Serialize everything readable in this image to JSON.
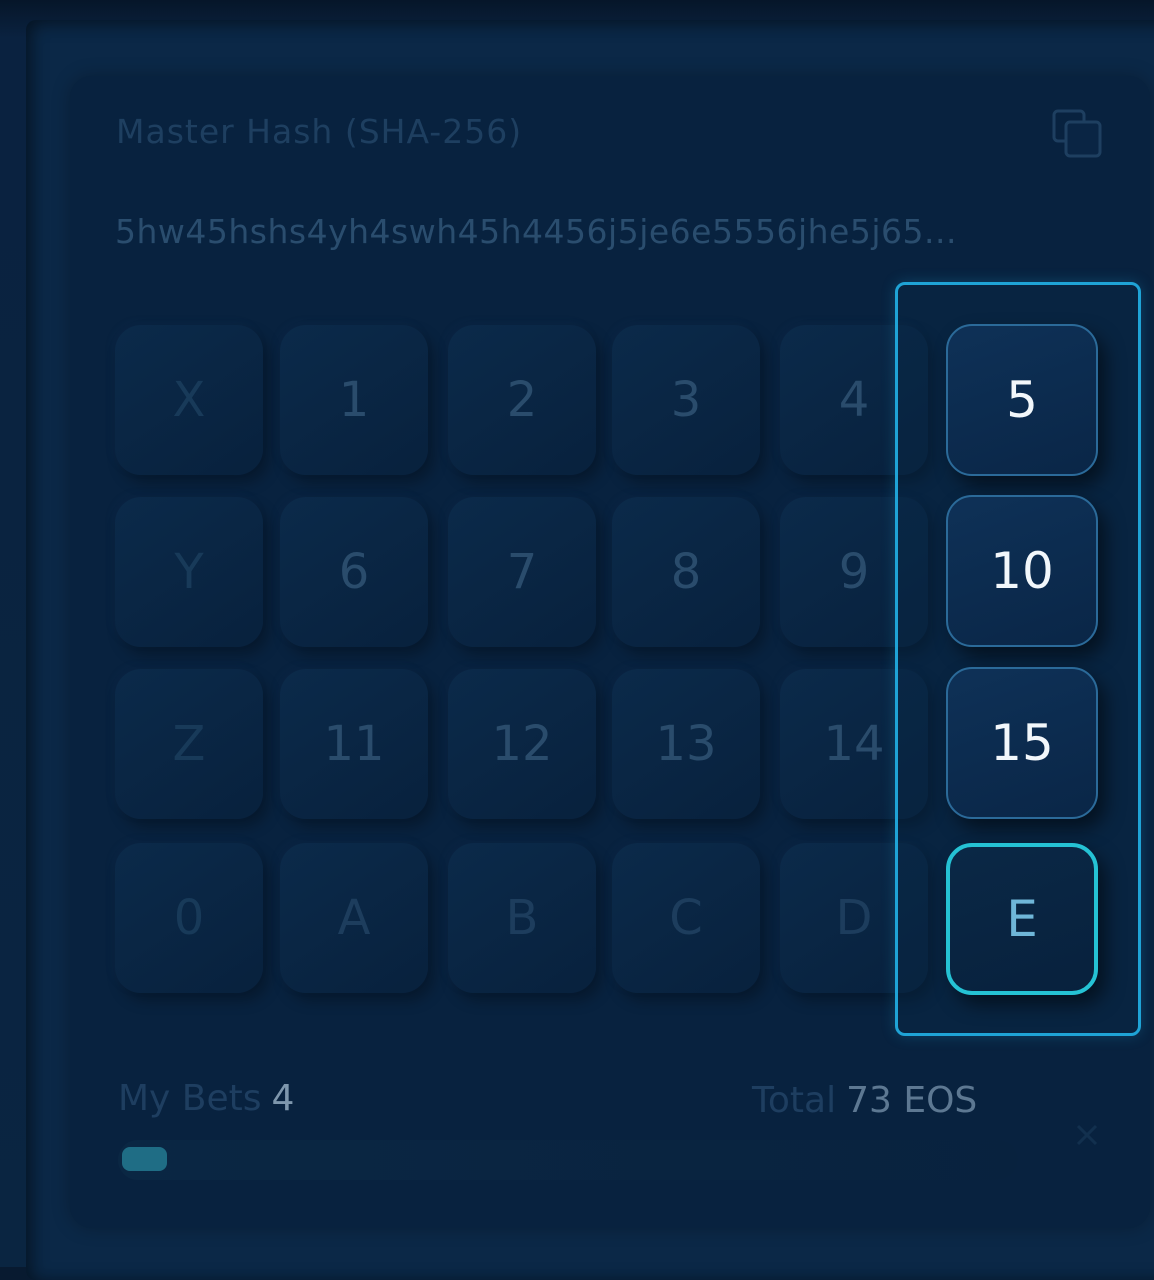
{
  "card": {
    "hash_label": "Master Hash (SHA-256)",
    "hash_value": "5hw45hshs4yh4swh45h4456j5je6e5556jhe5j65..."
  },
  "grid": {
    "rows": [
      [
        "X",
        "1",
        "2",
        "3",
        "4"
      ],
      [
        "Y",
        "6",
        "7",
        "8",
        "9"
      ],
      [
        "Z",
        "11",
        "12",
        "13",
        "14"
      ],
      [
        "0",
        "A",
        "B",
        "C",
        "D"
      ]
    ],
    "column": [
      "5",
      "10",
      "15",
      "E"
    ],
    "active_column_key": "E"
  },
  "footer": {
    "my_bets_label": "My Bets",
    "my_bets_value": "4",
    "total_label": "Total",
    "total_value": "73 EOS"
  },
  "progress": {
    "fraction": 0.05
  },
  "colors": {
    "accent": "#1fa3d6",
    "active_border": "#25c2d4",
    "background": "#08223f"
  },
  "icons": {
    "copy": "copy-icon",
    "close": "close-icon"
  }
}
